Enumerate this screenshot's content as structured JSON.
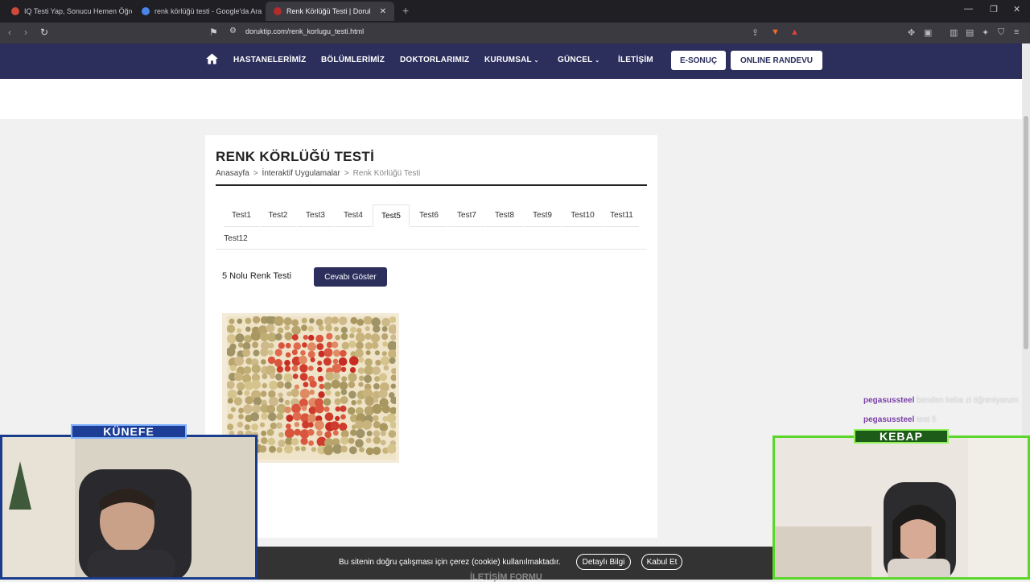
{
  "browser": {
    "tabs": [
      {
        "title": "IQ Testi Yap, Sonucu Hemen Öğren",
        "active": false
      },
      {
        "title": "renk körlüğü testi - Google'da Ara",
        "active": false
      },
      {
        "title": "Renk Körlüğü Testi | Doruk Sağlı",
        "active": true
      }
    ],
    "url": "doruktip.com/renk_korlugu_testi.html"
  },
  "nav": {
    "items": [
      "HASTANELERİMİZ",
      "BÖLÜMLERİMİZ",
      "DOKTORLARIMIZ",
      "KURUMSAL",
      "GÜNCEL",
      "İLETİŞİM"
    ],
    "esonuc": "E-SONUÇ",
    "randevu": "ONLINE RANDEVU"
  },
  "page": {
    "title": "RENK KÖRLÜĞÜ TESTİ",
    "breadcrumb": [
      "Anasayfa",
      "İnteraktif Uygulamalar",
      "Renk Körlüğü Testi"
    ],
    "breadcrumb_sep": ">",
    "tabs": [
      "Test1",
      "Test2",
      "Test3",
      "Test4",
      "Test5",
      "Test6",
      "Test7",
      "Test8",
      "Test9",
      "Test10",
      "Test11",
      "Test12"
    ],
    "active_tab": "Test5",
    "test_label": "5 Nolu Renk Testi",
    "answer_button": "Cevabı Göster",
    "section_peek": "İLETİŞİM FORMU"
  },
  "cookie": {
    "text": "Bu sitenin doğru çalışması için çerez (cookie) kullanılmaktadır.",
    "details": "Detaylı Bilgi",
    "accept": "Kabul Et"
  },
  "overlay": {
    "chat": [
      {
        "user": "pegasussteel",
        "message": "benden keba zi öğreniyorum"
      },
      {
        "user": "pegasussteel",
        "message": "test 5"
      }
    ],
    "cam_left_label": "KÜNEFE",
    "cam_right_label": "KEBAP"
  },
  "colors": {
    "nav_bg": "#2c2f5c",
    "accent": "#2c2f5c",
    "cookie_bg": "#333333"
  }
}
